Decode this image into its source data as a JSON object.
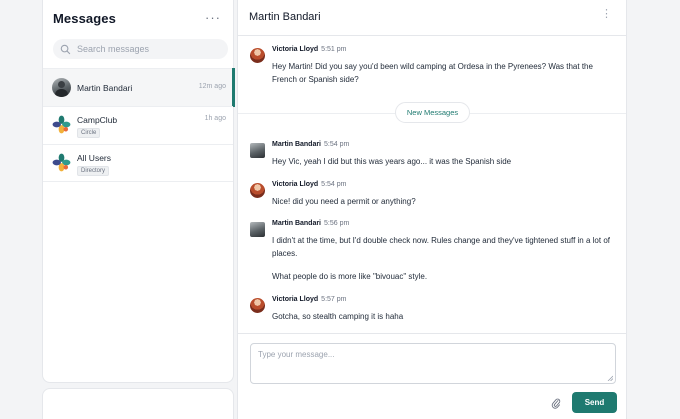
{
  "sidebar": {
    "title": "Messages",
    "more_label": "···",
    "search_placeholder": "Search messages",
    "conversations": [
      {
        "name": "Martin Bandari",
        "time": "12m ago",
        "badge": "",
        "avatar": "person-avatar",
        "active": true
      },
      {
        "name": "CampClub",
        "time": "1h ago",
        "badge": "Circle",
        "avatar": "campclub-logo-icon"
      },
      {
        "name": "All Users",
        "time": "",
        "badge": "Directory",
        "avatar": "campclub-logo-icon"
      }
    ]
  },
  "chat": {
    "title": "Martin Bandari",
    "menu_label": "⋮",
    "new_messages_label": "New Messages",
    "messages": [
      {
        "author": "Victoria Lloyd",
        "time": "5:51 pm",
        "text": "Hey Martin! Did you say you'd been wild camping at Ordesa in the Pyrenees? Was that the French or Spanish side?"
      },
      {
        "author": "Martin Bandari",
        "time": "5:54 pm",
        "text": "Hey Vic, yeah I did but this was years ago... it was the Spanish side"
      },
      {
        "author": "Victoria Lloyd",
        "time": "5:54 pm",
        "text": "Nice! did you need a permit or anything?"
      },
      {
        "author": "Martin Bandari",
        "time": "5:56 pm",
        "text": "I didn't at the time, but I'd double check now. Rules change and they've tightened stuff in a lot of places.",
        "text2": "What people do is more like \"bivouac\" style."
      },
      {
        "author": "Victoria Lloyd",
        "time": "5:57 pm",
        "text": "Gotcha, so stealth camping it is haha"
      }
    ]
  },
  "composer": {
    "placeholder": "Type your message...",
    "send_label": "Send"
  },
  "colors": {
    "accent": "#1f7a70",
    "logo": [
      "#1f7a70",
      "#2f9b8e",
      "#f2b13a",
      "#e86a3a",
      "#3d4a8c"
    ]
  }
}
